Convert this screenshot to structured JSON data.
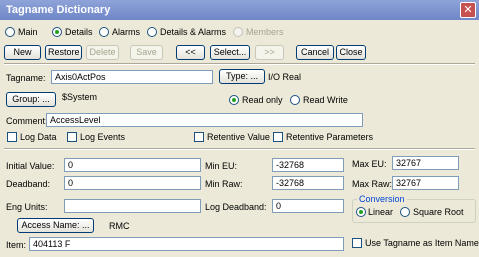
{
  "window": {
    "title": "Tagname Dictionary",
    "close_glyph": "✕"
  },
  "mode_radios": [
    {
      "label": "Main",
      "selected": false,
      "enabled": true
    },
    {
      "label": "Details",
      "selected": true,
      "enabled": true
    },
    {
      "label": "Alarms",
      "selected": false,
      "enabled": true
    },
    {
      "label": "Details & Alarms",
      "selected": false,
      "enabled": true
    },
    {
      "label": "Members",
      "selected": false,
      "enabled": false
    }
  ],
  "toolbar": {
    "new": "New",
    "restore": "Restore",
    "delete": "Delete",
    "save": "Save",
    "prev": "<<",
    "select": "Select...",
    "next": ">>",
    "cancel": "Cancel",
    "close": "Close"
  },
  "tag": {
    "tagname_label": "Tagname:",
    "tagname_value": "Axis0ActPos",
    "type_button": "Type: ...",
    "type_value": "I/O Real",
    "group_button": "Group: ...",
    "group_value": "$System",
    "read_only": "Read only",
    "read_write": "Read Write",
    "access": "read_only",
    "comment_label": "Comment:",
    "comment_value": "AccessLevel",
    "log_data": "Log Data",
    "log_events": "Log Events",
    "retentive_value": "Retentive Value",
    "retentive_parameters": "Retentive Parameters"
  },
  "details": {
    "initial_value_label": "Initial Value:",
    "initial_value": "0",
    "deadband_label": "Deadband:",
    "deadband": "0",
    "eng_units_label": "Eng Units:",
    "eng_units": "",
    "min_eu_label": "Min EU:",
    "min_eu": "-32768",
    "min_raw_label": "Min Raw:",
    "min_raw": "-32768",
    "log_deadband_label": "Log Deadband:",
    "log_deadband": "0",
    "max_eu_label": "Max EU:",
    "max_eu": "32767",
    "max_raw_label": "Max Raw:",
    "max_raw": "32767",
    "conversion_label": "Conversion",
    "linear": "Linear",
    "square_root": "Square Root",
    "conversion": "linear",
    "access_name_button": "Access Name: ...",
    "access_name_value": "RMC",
    "item_label": "Item:",
    "item_value": "404113 F",
    "use_tagname": "Use Tagname as Item Name"
  }
}
